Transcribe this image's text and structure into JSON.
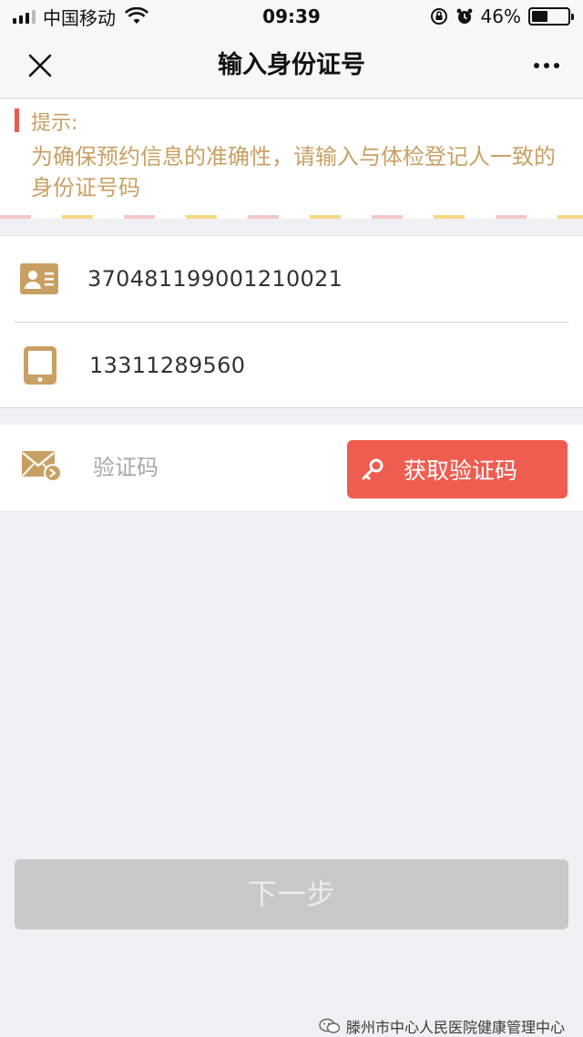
{
  "status_bar": {
    "carrier": "中国移动",
    "time": "09:39",
    "battery_percent": "46%",
    "battery_level": 0.46
  },
  "nav": {
    "title": "输入身份证号",
    "close_icon": "close-icon",
    "more_icon": "more-icon"
  },
  "notice": {
    "title": "提示:",
    "text": "为确保预约信息的准确性，请输入与体检登记人一致的身份证号码"
  },
  "form": {
    "id_number": "370481199001210021",
    "phone": "13311289560",
    "code_placeholder": "验证码",
    "get_code_label": "获取验证码"
  },
  "next_label": "下一步",
  "watermark": "滕州市中心人民医院健康管理中心",
  "colors": {
    "accent": "#ef5d50",
    "gold": "#c9a063",
    "disabled": "#c8c8c8"
  }
}
